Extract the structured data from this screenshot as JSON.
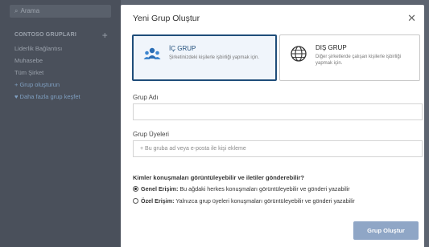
{
  "sidebar": {
    "search_placeholder": "Arama",
    "section_title": "CONTOSO GRUPLARI",
    "items": [
      "Liderlik Bağlantısı",
      "Muhasebe",
      "Tüm Şirket"
    ],
    "create_group_link": "+ Grup oluşturun",
    "more_groups_link": "Daha fazla grup keşfet"
  },
  "modal": {
    "title": "Yeni Grup Oluştur",
    "internal_card": {
      "title": "İÇ GRUP",
      "description": "Şirketinizdeki kişilerle işbirliği yapmak için."
    },
    "external_card": {
      "title": "DIŞ GRUP",
      "description": "Diğer şirketlerde çalışan kişilerle işbirliği yapmak için."
    },
    "group_name_label": "Grup Adı",
    "group_name_value": "",
    "members_label": "Grup Üyeleri",
    "members_placeholder": "+ Bu gruba ad veya e-posta ile kişi ekleme",
    "visibility_question": "Kimler konuşmaları görüntüleyebilir ve iletiler gönderebilir?",
    "public_option_title": "Genel Erişim:",
    "public_option_desc": " Bu ağdaki herkes konuşmaları görüntüleyebilir ve gönderi yazabilir",
    "private_option_title": "Özel Erişim:",
    "private_option_desc": " Yalnızca grup üyeleri konuşmaları görüntüleyebilir ve gönderi yazabilir",
    "selected_visibility": "public",
    "create_button": "Grup Oluştur"
  },
  "colors": {
    "accent": "#1f4d7a",
    "button_disabled": "#8fa6c6",
    "backdrop": "#5d6470"
  },
  "icons": {
    "internal": "people-group-icon",
    "external": "globe-icon",
    "close": "close-icon",
    "search": "search-icon"
  }
}
